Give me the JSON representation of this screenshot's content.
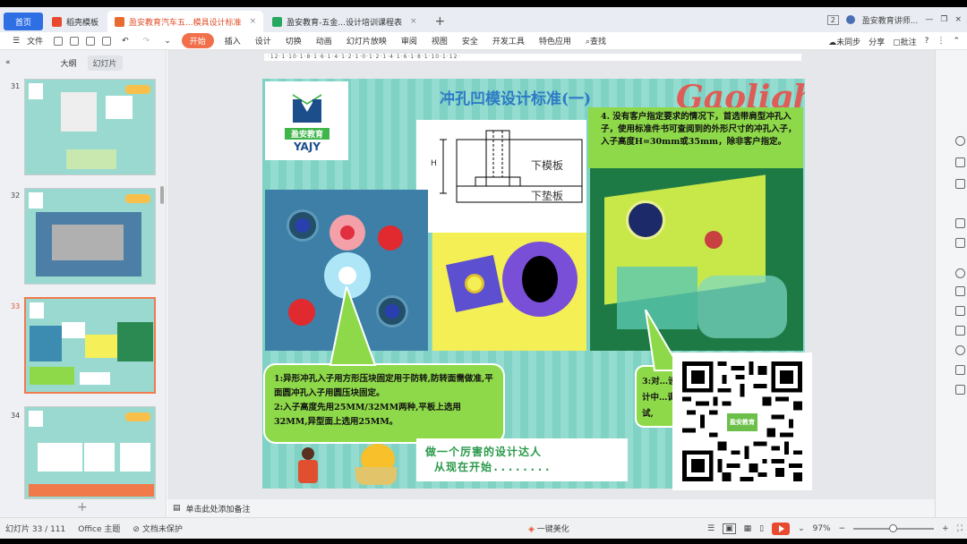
{
  "tabs": [
    {
      "label": "首页",
      "color": "#2f6fe4"
    },
    {
      "label": "稻壳模板",
      "color": "#e84a2f"
    },
    {
      "label": "盈安教育汽车五...模具设计标准",
      "color": "#e86a2f"
    },
    {
      "label": "盈安教育-五金...设计培训课程表",
      "color": "#28a760"
    }
  ],
  "tab_count": "2",
  "account": "盈安教育讲师...",
  "menu": {
    "file": "文件",
    "items": [
      "开始",
      "插入",
      "设计",
      "切换",
      "动画",
      "幻灯片放映",
      "审阅",
      "视图",
      "安全",
      "开发工具",
      "特色应用"
    ],
    "search": "查找",
    "sync": "未同步",
    "share": "分享",
    "comment": "批注"
  },
  "panel": {
    "outline": "大纲",
    "slides": "幻灯片"
  },
  "thumbs": [
    {
      "num": "31"
    },
    {
      "num": "32"
    },
    {
      "num": "33"
    },
    {
      "num": "34"
    }
  ],
  "ruler": "·12·1·10·1·8·1·6·1·4·1·2·1·0·1·2·1·4·1·6·1·8·1·10·1·12·",
  "slide": {
    "logo_cn": "盈安教育",
    "logo_en": "YAJY",
    "title": "冲孔凹模设计标准(一)",
    "deco": "Gaolight",
    "point4": "4. 没有客户指定要求的情况下，首选带肩型冲孔入子，使用标准件书可查阅到的外形尺寸的冲孔入子，入子高度H=30mm或35mm，除非客户指定。",
    "diagram_h": "H",
    "diagram_upper": "下模板",
    "diagram_lower": "下垫板",
    "callout1_line1": "1:异形冲孔入子用方形压块固定用于防转,防转面需做准,平面圆冲孔入子用圆压块固定。",
    "callout1_line2": "2:入子高度先用25MM/32MM两种,平板上选用32MM,异型面上选用25MM。",
    "callout3": "3:对…设计中…调试,",
    "slogan1": "做一个厉害的设计达人",
    "slogan2": "从现在开始........",
    "qr_badge": "盈安教育"
  },
  "notes_placeholder": "单击此处添加备注",
  "status": {
    "slide_count": "幻灯片 33 / 111",
    "theme": "Office 主题",
    "protect": "文档未保护",
    "beautify": "一键美化",
    "zoom": "97%"
  },
  "colors": {
    "accent": "#f26f4b",
    "slide_green": "#7fd2c4",
    "callout_green": "#8ed94a"
  }
}
